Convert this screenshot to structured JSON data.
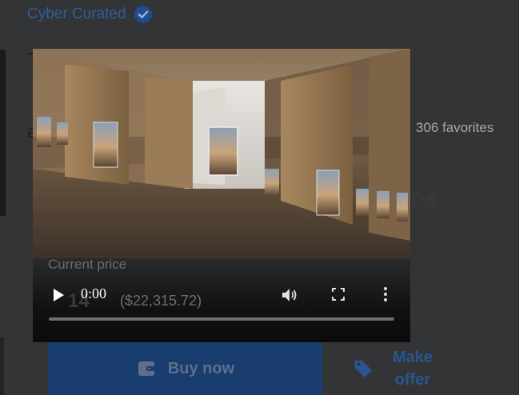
{
  "header": {
    "collection_name": "Cyber Curated"
  },
  "background": {
    "title_fragment": "T",
    "owner_fragment": "a",
    "favorites": "306 favorites",
    "tz_fragment": "T+8"
  },
  "price": {
    "label": "Current price",
    "usd": "($22,315.72)",
    "value_fragment": "14"
  },
  "actions": {
    "buy_label": "Buy now",
    "offer_label_line1": "Make",
    "offer_label_line2": "offer"
  },
  "player": {
    "time": "0:00",
    "progress": 0
  },
  "colors": {
    "accent": "#2f5f9e",
    "buy_button": "#1a3d70",
    "player_bg": "#0b0b0b"
  },
  "icons": [
    "verified-icon",
    "wallet-icon",
    "tag-icon",
    "play-icon",
    "volume-icon",
    "fullscreen-icon",
    "more-vertical-icon"
  ]
}
